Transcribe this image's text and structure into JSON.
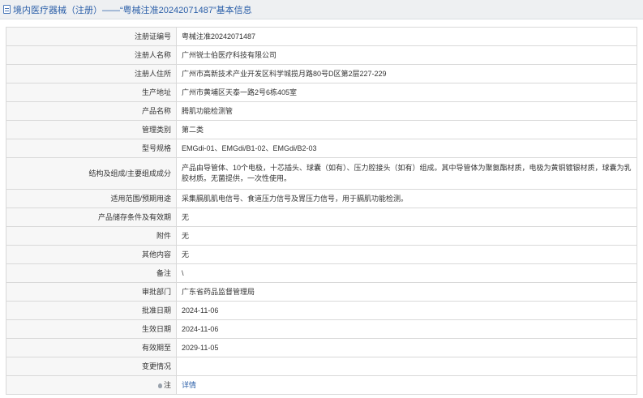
{
  "header": {
    "title": "境内医疗器械（注册）——“粤械注准20242071487”基本信息",
    "icon": "document-icon"
  },
  "rows": [
    {
      "label": "注册证编号",
      "value": "粤械注准20242071487"
    },
    {
      "label": "注册人名称",
      "value": "广州锐士伯医疗科技有限公司"
    },
    {
      "label": "注册人住所",
      "value": "广州市高新技术产业开发区科学城揽月路80号D区第2层227-229"
    },
    {
      "label": "生产地址",
      "value": "广州市黄埔区天泰一路2号6栋405室"
    },
    {
      "label": "产品名称",
      "value": "腾肌功能检测管"
    },
    {
      "label": "管理类别",
      "value": "第二类"
    },
    {
      "label": "型号规格",
      "value": "EMGdi-01、EMGdi/B1-02、EMGdi/B2-03"
    },
    {
      "label": "结构及组成/主要组成成分",
      "value": "产品由导管体、10个电极，十芯插头、球囊（如有）、压力腔接头（如有）组成。其中导管体为聚氨酯材质，电极为黄铜镀银材质，球囊为乳胶材质。无菌提供，一次性使用。"
    },
    {
      "label": "适用范围/预期用途",
      "value": "采集膈肌肌电信号、食道压力信号及胃压力信号，用于膈肌功能检测。"
    },
    {
      "label": "产品储存条件及有效期",
      "value": "无"
    },
    {
      "label": "附件",
      "value": "无"
    },
    {
      "label": "其他内容",
      "value": "无"
    },
    {
      "label": "备注",
      "value": "\\"
    },
    {
      "label": "审批部门",
      "value": "广东省药品监督管理局"
    },
    {
      "label": "批准日期",
      "value": "2024-11-06"
    },
    {
      "label": "生效日期",
      "value": "2024-11-06"
    },
    {
      "label": "有效期至",
      "value": "2029-11-05"
    },
    {
      "label": "变更情况",
      "value": ""
    }
  ],
  "note_row": {
    "icon": "bulb-icon",
    "label": "注",
    "link": "详情"
  }
}
